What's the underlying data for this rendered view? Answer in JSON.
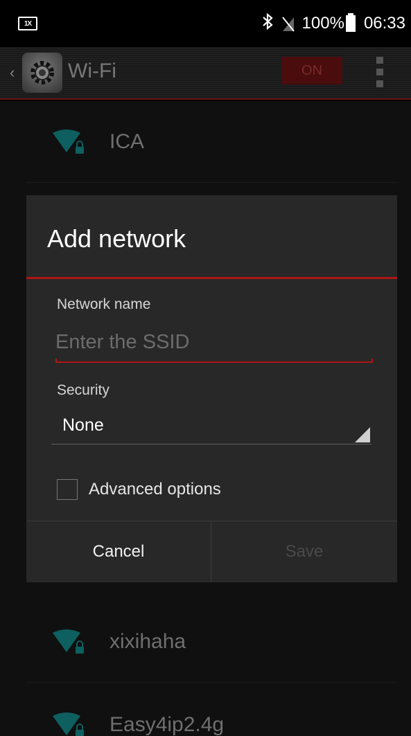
{
  "status_bar": {
    "left_icon_text": "1X",
    "battery": "100%",
    "time": "06:33",
    "icons": [
      "keyboard-icon",
      "bluetooth-icon",
      "no-signal-icon",
      "battery-icon"
    ]
  },
  "action_bar": {
    "up_caret": "‹",
    "title": "Wi-Fi",
    "toggle": "ON",
    "accent_color": "#b01616"
  },
  "networks": [
    {
      "ssid": "ICA",
      "icon": "wifi-locked-icon"
    },
    {
      "ssid": "xixihaha",
      "icon": "wifi-locked-icon"
    },
    {
      "ssid": "Easy4ip2.4g",
      "icon": "wifi-locked-icon"
    }
  ],
  "dialog": {
    "title": "Add network",
    "network_name_label": "Network name",
    "ssid_placeholder": "Enter the SSID",
    "ssid_value": "",
    "security_label": "Security",
    "security_value": "None",
    "advanced_label": "Advanced options",
    "advanced_checked": false,
    "cancel": "Cancel",
    "save": "Save"
  }
}
